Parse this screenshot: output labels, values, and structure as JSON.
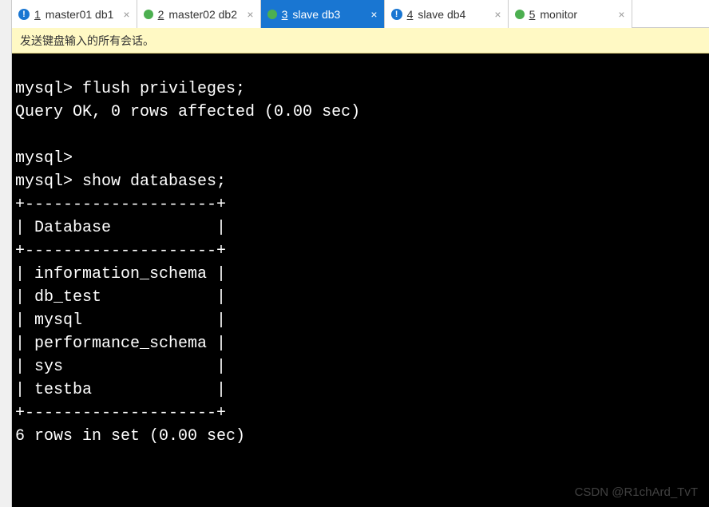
{
  "tabs": [
    {
      "num": "1",
      "label": "master01 db1",
      "status": "warn",
      "color": "#1976d2",
      "active": false
    },
    {
      "num": "2",
      "label": "master02 db2",
      "status": "dot",
      "color": "#4caf50",
      "active": false
    },
    {
      "num": "3",
      "label": "slave db3",
      "status": "dot",
      "color": "#4caf50",
      "active": true
    },
    {
      "num": "4",
      "label": "slave db4",
      "status": "warn",
      "color": "#1976d2",
      "active": false
    },
    {
      "num": "5",
      "label": "monitor",
      "status": "dot",
      "color": "#4caf50",
      "active": false
    }
  ],
  "info_bar": "发送键盘输入的所有会话。",
  "terminal_lines": [
    "mysql> flush privileges;",
    "Query OK, 0 rows affected (0.00 sec)",
    "",
    "mysql>",
    "mysql> show databases;",
    "+--------------------+",
    "| Database           |",
    "+--------------------+",
    "| information_schema |",
    "| db_test            |",
    "| mysql              |",
    "| performance_schema |",
    "| sys                |",
    "| testba             |",
    "+--------------------+",
    "6 rows in set (0.00 sec)"
  ],
  "watermark": "CSDN @R1chArd_TvT",
  "close_glyph": "×",
  "warn_glyph": "!"
}
